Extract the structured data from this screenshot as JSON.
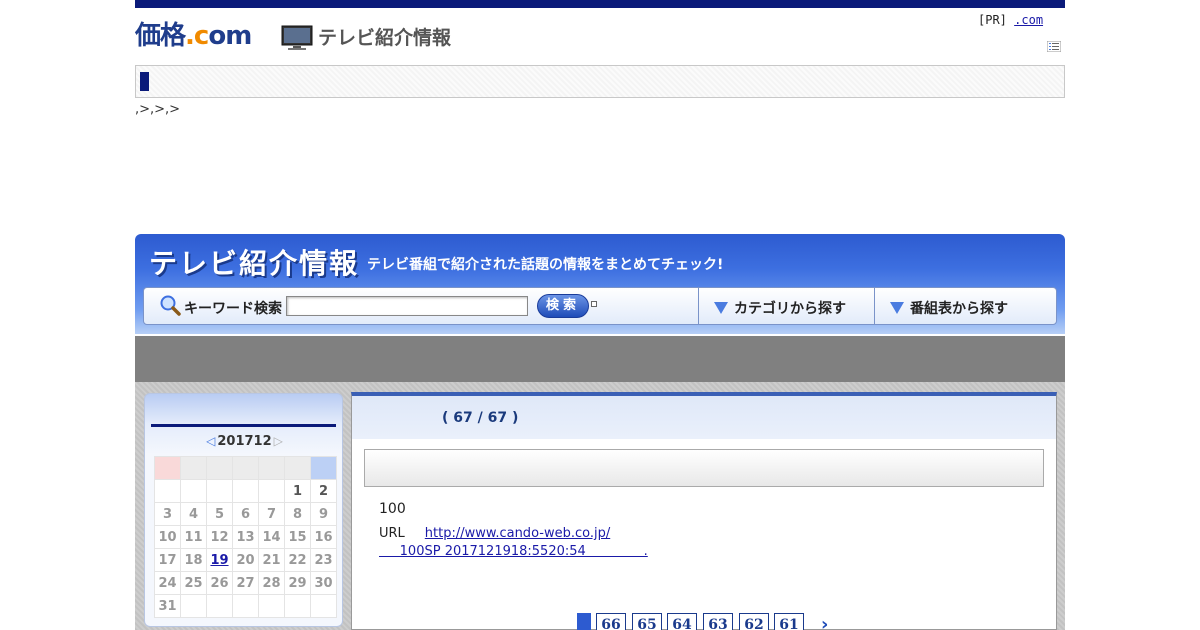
{
  "header": {
    "logo_kakaku_main": "価格",
    "logo_kakaku_dot": ".",
    "logo_kakaku_c": "c",
    "logo_kakaku_om": "om",
    "logo_tv": "テレビ紹介情報",
    "pr_prefix": "[PR]",
    "pr_link": ".com   "
  },
  "breadcrumb": ",>,>,>",
  "banner": {
    "title": "テレビ紹介情報",
    "subtitle": "テレビ番組で紹介された話題の情報をまとめてチェック!",
    "search_label": "キーワード検索",
    "search_value": "",
    "search_button": "検索",
    "category_link": "カテゴリから探す",
    "program_link": "番組表から探す"
  },
  "calendar": {
    "month": "201712",
    "prev_icon": "◁",
    "next_icon": "▷",
    "weeks": [
      [
        "",
        "",
        "",
        "",
        "",
        "1",
        "2"
      ],
      [
        "3",
        "4",
        "5",
        "6",
        "7",
        "8",
        "9"
      ],
      [
        "10",
        "11",
        "12",
        "13",
        "14",
        "15",
        "16"
      ],
      [
        "17",
        "18",
        "19",
        "20",
        "21",
        "22",
        "23"
      ],
      [
        "24",
        "25",
        "26",
        "27",
        "28",
        "29",
        "30"
      ],
      [
        "31",
        "",
        "",
        "",
        "",
        "",
        ""
      ]
    ],
    "linked_day": "19"
  },
  "main": {
    "counter": "( 67 / 67  )",
    "value": "100",
    "url_label": "URL",
    "url": "http://www.cando-web.co.jp/",
    "info_line": "     100SP 2017121918:5520:54              ."
  },
  "pager": {
    "pages": [
      "66",
      "65",
      "64",
      "63",
      "62",
      "61"
    ],
    "next_icon": "›"
  },
  "colors": {
    "navy": "#0a1a7a",
    "banner_blue": "#2d5bd0",
    "link": "#1a1aa8"
  }
}
